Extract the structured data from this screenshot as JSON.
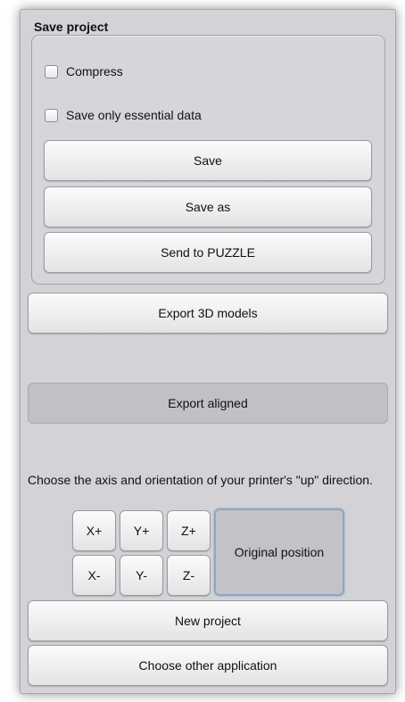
{
  "save_group": {
    "title": "Save project",
    "compress_label": "Compress",
    "essential_label": "Save only essential data",
    "save_label": "Save",
    "save_as_label": "Save as",
    "send_label": "Send to PUZZLE"
  },
  "export_models_label": "Export 3D models",
  "export_aligned_label": "Export aligned",
  "orientation": {
    "instruction": "Choose the axis and orientation of your printer's \"up\" direction.",
    "x_plus": "X+",
    "y_plus": "Y+",
    "z_plus": "Z+",
    "x_minus": "X-",
    "y_minus": "Y-",
    "z_minus": "Z-",
    "original_label": "Original position"
  },
  "new_project_label": "New project",
  "choose_app_label": "Choose other application"
}
